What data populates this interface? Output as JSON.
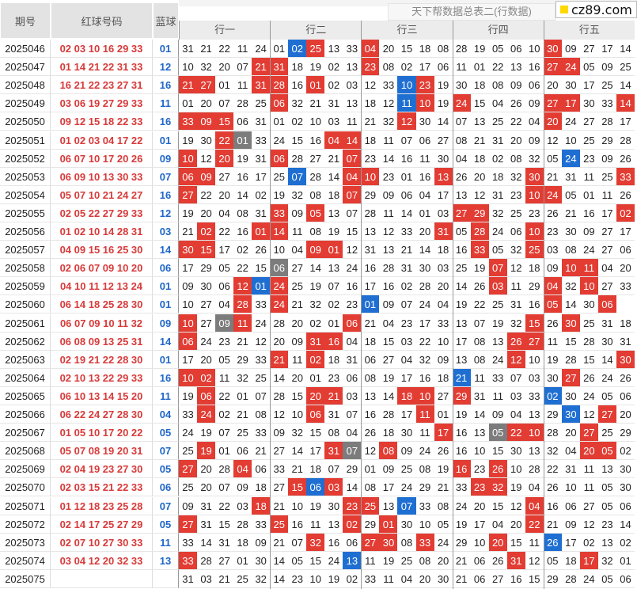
{
  "header": {
    "period_label": "期号",
    "red_label": "红球号码",
    "blue_label": "蓝球",
    "title": "天下帮数据总表二(行数据)",
    "logo": "cz89.com"
  },
  "groups": [
    "行一",
    "行二",
    "行三",
    "行四",
    "行五"
  ],
  "colors": {
    "red_highlight": "#e23c33",
    "blue_highlight": "#1f6fd2",
    "gray_highlight": "#7c7c7c",
    "red_text": "#d83a3a",
    "blue_text": "#1f66c8"
  },
  "rows": [
    {
      "period": "2025046",
      "reds": "02 03 10 16 29 33",
      "blue": "01",
      "nums": [
        "31",
        "21",
        "22",
        "11",
        "24",
        "01",
        "02",
        "25",
        "13",
        "33",
        "04",
        "20",
        "15",
        "18",
        "08",
        "28",
        "19",
        "05",
        "06",
        "10",
        "30",
        "09",
        "27",
        "17",
        "14"
      ],
      "hl": "....._BR..R.........R.....R"
    },
    {
      "period": "2025047",
      "reds": "01 14 21 22 31 33",
      "blue": "12",
      "nums": [
        "10",
        "32",
        "20",
        "07",
        "21",
        "31",
        "18",
        "19",
        "02",
        "13",
        "23",
        "08",
        "02",
        "17",
        "06",
        "11",
        "01",
        "22",
        "13",
        "16",
        "27",
        "24",
        "05",
        "09",
        "25"
      ],
      "hl": "....RR....R.........RR...."
    },
    {
      "period": "2025048",
      "reds": "16 21 22 23 27 31",
      "blue": "16",
      "nums": [
        "21",
        "27",
        "01",
        "11",
        "31",
        "28",
        "16",
        "01",
        "02",
        "03",
        "12",
        "33",
        "10",
        "23",
        "19",
        "30",
        "18",
        "08",
        "09",
        "06",
        "20",
        "30",
        "17",
        "25",
        "14"
      ],
      "hl": "RR..RR.R....BR............"
    },
    {
      "period": "2025049",
      "reds": "03 06 19 27 29 33",
      "blue": "11",
      "nums": [
        "01",
        "20",
        "07",
        "28",
        "25",
        "06",
        "32",
        "21",
        "31",
        "13",
        "18",
        "12",
        "11",
        "10",
        "19",
        "24",
        "15",
        "04",
        "26",
        "09",
        "27",
        "17",
        "30",
        "33",
        "14"
      ],
      "hl": ".....R......BR.R....RR..R."
    },
    {
      "period": "2025050",
      "reds": "09 12 15 18 22 33",
      "blue": "16",
      "nums": [
        "33",
        "09",
        "15",
        "06",
        "31",
        "01",
        "02",
        "10",
        "03",
        "11",
        "21",
        "32",
        "12",
        "30",
        "14",
        "07",
        "13",
        "25",
        "22",
        "04",
        "20",
        "24",
        "27",
        "28",
        "17"
      ],
      "hl": "RRR.........R.......R....."
    },
    {
      "period": "2025051",
      "reds": "01 02 03 04 17 22",
      "blue": "01",
      "nums": [
        "19",
        "30",
        "22",
        "01",
        "33",
        "24",
        "15",
        "16",
        "04",
        "14",
        "18",
        "11",
        "07",
        "06",
        "27",
        "08",
        "21",
        "31",
        "20",
        "09",
        "12",
        "10",
        "25",
        "29",
        "28"
      ],
      "hl": "..RG....RR................"
    },
    {
      "period": "2025052",
      "reds": "06 07 10 17 20 26",
      "blue": "09",
      "nums": [
        "10",
        "12",
        "20",
        "19",
        "31",
        "06",
        "28",
        "27",
        "21",
        "07",
        "23",
        "14",
        "16",
        "11",
        "30",
        "04",
        "18",
        "02",
        "08",
        "32",
        "05",
        "24",
        "23",
        "09",
        "26"
      ],
      "hl": "R.R..R...R...........B..."
    },
    {
      "period": "2025053",
      "reds": "06 09 10 13 30 33",
      "blue": "07",
      "nums": [
        "06",
        "09",
        "27",
        "16",
        "17",
        "25",
        "07",
        "28",
        "14",
        "04",
        "10",
        "23",
        "01",
        "16",
        "13",
        "26",
        "20",
        "18",
        "32",
        "30",
        "21",
        "31",
        "11",
        "25",
        "33"
      ],
      "hl": "RR....B..RR...R....R....R"
    },
    {
      "period": "2025054",
      "reds": "05 07 10 21 24 27",
      "blue": "16",
      "nums": [
        "27",
        "22",
        "20",
        "14",
        "02",
        "19",
        "32",
        "08",
        "18",
        "07",
        "29",
        "09",
        "06",
        "04",
        "17",
        "13",
        "12",
        "31",
        "23",
        "10",
        "24",
        "05",
        "01",
        "11",
        "26"
      ],
      "hl": "R........R.........RR...."
    },
    {
      "period": "2025055",
      "reds": "02 05 22 27 29 33",
      "blue": "12",
      "nums": [
        "19",
        "20",
        "04",
        "08",
        "31",
        "33",
        "09",
        "05",
        "13",
        "07",
        "28",
        "11",
        "14",
        "01",
        "03",
        "27",
        "29",
        "32",
        "25",
        "23",
        "26",
        "21",
        "16",
        "17",
        "02"
      ],
      "hl": ".....R.R.......RR.......R"
    },
    {
      "period": "2025056",
      "reds": "01 02 10 14 28 31",
      "blue": "03",
      "nums": [
        "21",
        "02",
        "22",
        "16",
        "01",
        "14",
        "11",
        "08",
        "19",
        "15",
        "13",
        "12",
        "33",
        "20",
        "31",
        "05",
        "28",
        "24",
        "06",
        "10",
        "23",
        "30",
        "09",
        "27",
        "17"
      ],
      "hl": ".R..RR........R.R..R....."
    },
    {
      "period": "2025057",
      "reds": "04 09 15 16 25 30",
      "blue": "14",
      "nums": [
        "30",
        "15",
        "17",
        "02",
        "26",
        "10",
        "04",
        "09",
        "01",
        "12",
        "31",
        "13",
        "21",
        "14",
        "18",
        "16",
        "33",
        "05",
        "32",
        "25",
        "03",
        "08",
        "24",
        "27",
        "06"
      ],
      "hl": "RR.....RR.......R..R......"
    },
    {
      "period": "2025058",
      "reds": "02 06 07 09 10 20",
      "blue": "06",
      "nums": [
        "17",
        "29",
        "05",
        "22",
        "15",
        "06",
        "27",
        "14",
        "13",
        "24",
        "16",
        "28",
        "31",
        "30",
        "03",
        "25",
        "19",
        "07",
        "12",
        "18",
        "09",
        "10",
        "11",
        "04",
        "20"
      ],
      "hl": ".....G...........R...RR..R"
    },
    {
      "period": "2025059",
      "reds": "04 10 11 12 13 24",
      "blue": "01",
      "nums": [
        "09",
        "30",
        "06",
        "12",
        "01",
        "24",
        "25",
        "19",
        "07",
        "16",
        "17",
        "16",
        "02",
        "28",
        "20",
        "14",
        "26",
        "03",
        "11",
        "29",
        "04",
        "32",
        "10",
        "27",
        "33"
      ],
      "hl": "...RBR...........R..R.R.."
    },
    {
      "period": "2025060",
      "reds": "06 14 18 25 28 30",
      "blue": "01",
      "nums": [
        "10",
        "27",
        "04",
        "28",
        "33",
        "24",
        "21",
        "32",
        "02",
        "23",
        "01",
        "09",
        "07",
        "24",
        "04",
        "19",
        "22",
        "25",
        "31",
        "16",
        "05",
        "14",
        "30",
        "06"
      ],
      "hl": "...R.R....B.........R..RR"
    },
    {
      "period": "2025061",
      "reds": "06 07 09 10 11 32",
      "blue": "09",
      "nums": [
        "10",
        "27",
        "09",
        "11",
        "24",
        "28",
        "20",
        "02",
        "01",
        "06",
        "21",
        "04",
        "23",
        "17",
        "33",
        "13",
        "07",
        "19",
        "32",
        "15",
        "26",
        "30",
        "25",
        "31",
        "18"
      ],
      "hl": "R.GR.....R.........R.R......"
    },
    {
      "period": "2025062",
      "reds": "06 08 09 13 25 31",
      "blue": "14",
      "nums": [
        "06",
        "24",
        "23",
        "21",
        "12",
        "20",
        "09",
        "31",
        "16",
        "04",
        "18",
        "15",
        "03",
        "22",
        "10",
        "17",
        "08",
        "13",
        "26",
        "27",
        "11",
        "15",
        "28",
        "30",
        "31"
      ],
      "hl": "R......RR.........RR.....R"
    },
    {
      "period": "2025063",
      "reds": "02 19 21 22 28 30",
      "blue": "01",
      "nums": [
        "17",
        "20",
        "05",
        "29",
        "33",
        "21",
        "11",
        "02",
        "18",
        "31",
        "06",
        "27",
        "04",
        "32",
        "09",
        "13",
        "08",
        "24",
        "12",
        "10",
        "19",
        "28",
        "15",
        "14",
        "30"
      ],
      "hl": ".....R.R..........R.....RR..R"
    },
    {
      "period": "2025064",
      "reds": "02 10 13 22 29 33",
      "blue": "16",
      "nums": [
        "10",
        "02",
        "11",
        "32",
        "25",
        "14",
        "20",
        "01",
        "23",
        "06",
        "08",
        "19",
        "17",
        "16",
        "18",
        "21",
        "11",
        "33",
        "07",
        "03",
        "30",
        "27",
        "26",
        "24",
        "26"
      ],
      "hl": "RR.............B.....R......"
    },
    {
      "period": "2025065",
      "reds": "06 10 13 14 15 20",
      "blue": "11",
      "nums": [
        "19",
        "06",
        "22",
        "01",
        "07",
        "28",
        "15",
        "20",
        "21",
        "03",
        "13",
        "14",
        "18",
        "10",
        "27",
        "29",
        "31",
        "11",
        "03",
        "33",
        "02",
        "30",
        "24",
        "05",
        "06"
      ],
      "hl": ".R.....RR...RR.R....B........"
    },
    {
      "period": "2025066",
      "reds": "06 22 24 27 28 30",
      "blue": "04",
      "nums": [
        "33",
        "24",
        "02",
        "21",
        "08",
        "12",
        "10",
        "06",
        "31",
        "07",
        "16",
        "28",
        "17",
        "11",
        "01",
        "19",
        "14",
        "09",
        "04",
        "13",
        "29",
        "30",
        "12",
        "27",
        "20"
      ],
      "hl": ".R.....R.....R.......B.R..R."
    },
    {
      "period": "2025067",
      "reds": "01 05 10 17 20 22",
      "blue": "05",
      "nums": [
        "24",
        "19",
        "07",
        "25",
        "33",
        "09",
        "32",
        "15",
        "08",
        "04",
        "26",
        "18",
        "30",
        "11",
        "17",
        "16",
        "13",
        "05",
        "22",
        "10",
        "28",
        "20",
        "27",
        "25",
        "29"
      ],
      "hl": "..............R..GRR..R...."
    },
    {
      "period": "2025068",
      "reds": "05 07 08 19 20 31",
      "blue": "07",
      "nums": [
        "25",
        "19",
        "01",
        "06",
        "21",
        "27",
        "14",
        "17",
        "31",
        "07",
        "12",
        "08",
        "09",
        "24",
        "26",
        "16",
        "10",
        "15",
        "30",
        "13",
        "32",
        "04",
        "20",
        "05",
        "02"
      ],
      "hl": ".R......RG.R..........RR..R"
    },
    {
      "period": "2025069",
      "reds": "02 04 19 23 27 30",
      "blue": "05",
      "nums": [
        "27",
        "20",
        "28",
        "04",
        "06",
        "33",
        "21",
        "18",
        "07",
        "29",
        "01",
        "09",
        "25",
        "08",
        "19",
        "16",
        "23",
        "26",
        "10",
        "28",
        "22",
        "31",
        "11",
        "13",
        "30"
      ],
      "hl": "R..R...........R.R.........R"
    },
    {
      "period": "2025070",
      "reds": "02 03 15 21 22 33",
      "blue": "06",
      "nums": [
        "25",
        "20",
        "07",
        "09",
        "18",
        "27",
        "15",
        "06",
        "03",
        "14",
        "08",
        "17",
        "24",
        "29",
        "21",
        "33",
        "23",
        "32",
        "19",
        "04",
        "26",
        "10",
        "11",
        "05",
        "30"
      ],
      "hl": "......RBR.......RR..........."
    },
    {
      "period": "2025071",
      "reds": "01 12 18 23 25 28",
      "blue": "07",
      "nums": [
        "09",
        "31",
        "22",
        "03",
        "18",
        "21",
        "10",
        "19",
        "30",
        "23",
        "25",
        "13",
        "07",
        "33",
        "08",
        "24",
        "20",
        "15",
        "12",
        "04",
        "16",
        "06",
        "27",
        "05",
        "06"
      ],
      "hl": "....R....RR.B......R......."
    },
    {
      "period": "2025072",
      "reds": "02 14 17 25 27 29",
      "blue": "05",
      "nums": [
        "27",
        "31",
        "15",
        "28",
        "33",
        "25",
        "16",
        "11",
        "13",
        "02",
        "29",
        "01",
        "30",
        "10",
        "05",
        "19",
        "17",
        "04",
        "20",
        "22",
        "21",
        "09",
        "12",
        "23",
        "14"
      ],
      "hl": "R....R...R.R.......R.....R"
    },
    {
      "period": "2025073",
      "reds": "02 07 10 27 30 33",
      "blue": "11",
      "nums": [
        "33",
        "14",
        "31",
        "18",
        "09",
        "21",
        "07",
        "32",
        "16",
        "06",
        "27",
        "30",
        "08",
        "33",
        "24",
        "29",
        "10",
        "20",
        "15",
        "11",
        "26",
        "17",
        "02",
        "13",
        "02"
      ],
      "hl": ".......R..RR.R...R..B......"
    },
    {
      "period": "2025074",
      "reds": "03 04 12 20 32 33",
      "blue": "13",
      "nums": [
        "33",
        "28",
        "27",
        "01",
        "30",
        "14",
        "05",
        "15",
        "24",
        "13",
        "11",
        "19",
        "25",
        "08",
        "20",
        "21",
        "06",
        "26",
        "31",
        "12",
        "05",
        "18",
        "17",
        "32",
        "01"
      ],
      "hl": "R........B........R...R..R"
    },
    {
      "period": "2025075",
      "reds": "",
      "blue": "",
      "nums": [
        "31",
        "03",
        "21",
        "25",
        "32",
        "14",
        "23",
        "10",
        "19",
        "02",
        "33",
        "11",
        "04",
        "20",
        "30",
        "21",
        "06",
        "27",
        "16",
        "15",
        "29",
        "28",
        "24",
        "05",
        "06"
      ],
      "hl": ""
    }
  ]
}
